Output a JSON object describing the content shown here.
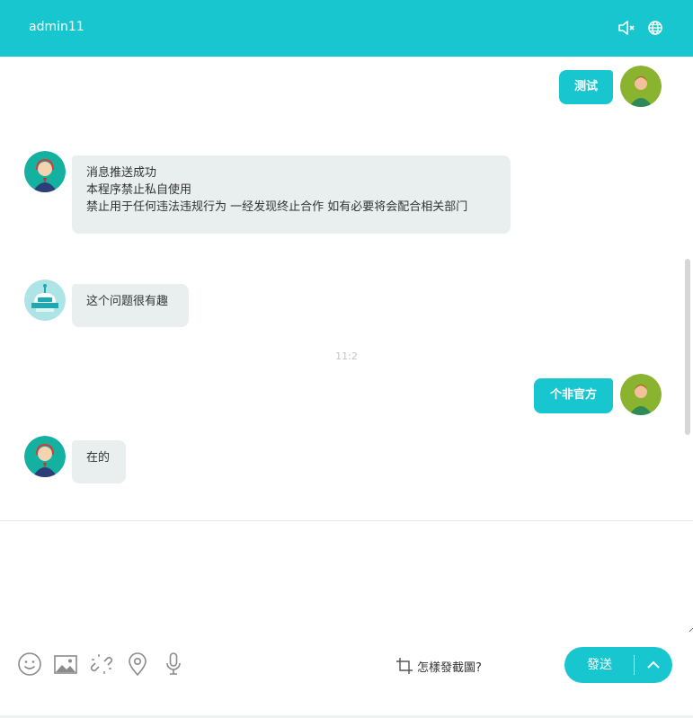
{
  "header": {
    "title": "admin11"
  },
  "messages": [
    {
      "side": "out",
      "text": "测试"
    },
    {
      "side": "in",
      "lines": [
        "消息推送成功",
        "本程序禁止私自使用",
        "禁止用于任何违法违规行为 一经发现终止合作 如有必要将会配合相关部门"
      ]
    },
    {
      "side": "in",
      "text": "这个问题很有趣"
    },
    {
      "side": "out",
      "text": "个非官方"
    },
    {
      "side": "in",
      "text": "在的"
    }
  ],
  "timestamp": "11:2",
  "toolbar": {
    "icons": [
      "smiley-icon",
      "image-icon",
      "link-icon",
      "location-icon",
      "microphone-icon"
    ],
    "screenshot_label": "怎樣發截圖?",
    "send_label": "發送"
  },
  "colors": {
    "accent": "#18c6cf",
    "bubble_in": "#e9efef"
  }
}
